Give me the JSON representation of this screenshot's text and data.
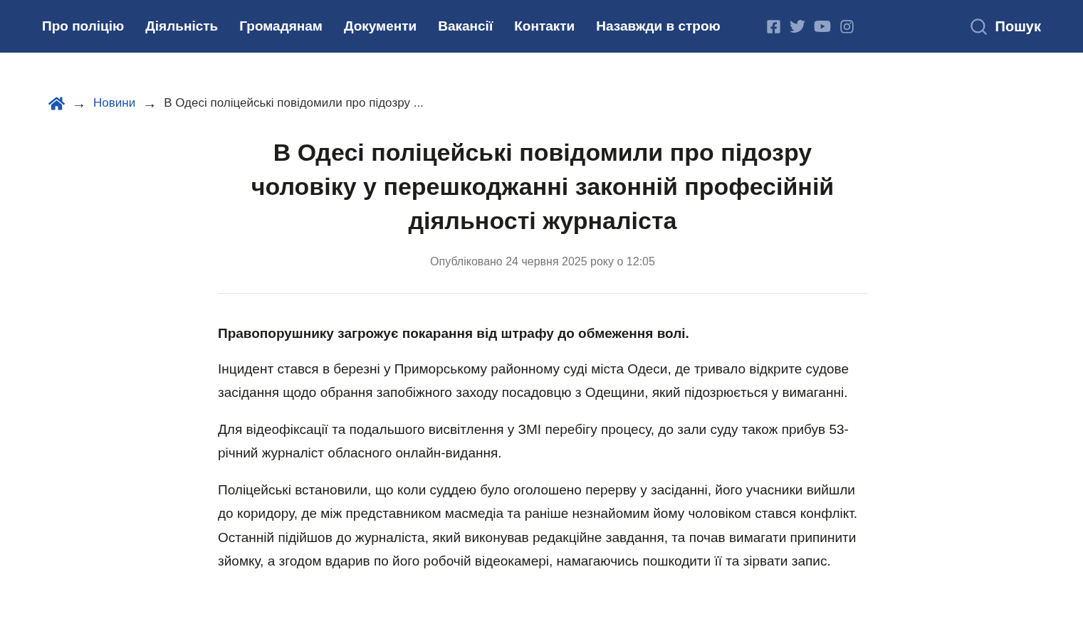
{
  "nav": {
    "items": [
      "Про поліцію",
      "Діяльність",
      "Громадянам",
      "Документи",
      "Вакансії",
      "Контакти",
      "Назавжди в строю"
    ],
    "search": "Пошук"
  },
  "breadcrumb": {
    "separator": "→",
    "items": [
      "Новини",
      "В Одесі поліцейські повідомили про підозру ..."
    ]
  },
  "article": {
    "title": "В Одесі поліцейські повідомили про підозру чоловіку у перешкоджанні законній професійній діяльності журналіста",
    "published": "Опубліковано 24 червня 2025 року о 12:05",
    "lead": "Правопорушнику загрожує покарання від штрафу до обмеження волі.",
    "paragraphs": [
      "Інцидент стався в березні у Приморському районному суді міста Одеси, де тривало відкрите судове засідання щодо обрання запобіжного заходу посадовцю з Одещини, який підозрюється у вимаганні.",
      "Для відеофіксації та подальшого висвітлення у ЗМІ перебігу процесу, до зали суду також прибув  53-річний журналіст обласного онлайн-видання.",
      "Поліцейські встановили, що коли суддею було оголошено перерву у засіданні, його учасники вийшли до коридору, де між представником масмедіа та раніше незнайомим йому чоловіком стався конфлікт. Останній підійшов до журналіста, який виконував редакційне завдання, та почав вимагати припинити зйомку, а згодом вдарив по його робочій відеокамері, намагаючись пошкодити її та зірвати запис."
    ]
  }
}
